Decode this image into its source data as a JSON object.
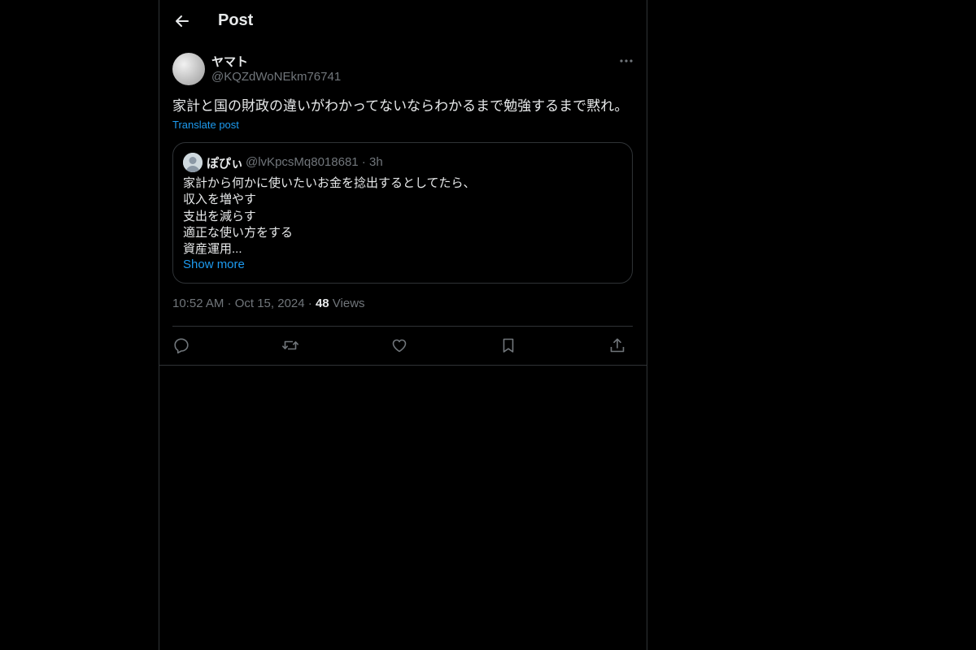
{
  "header": {
    "title": "Post",
    "back_icon": "arrow-left-icon"
  },
  "post": {
    "author_name": "ヤマト",
    "author_handle": "@KQZdWoNEkm76741",
    "text": "家計と国の財政の違いがわかってないならわかるまで勉強するまで黙れ。",
    "translate_label": "Translate post",
    "time": "10:52 AM · Oct 15, 2024 · ",
    "views_count": "48",
    "views_label": " Views"
  },
  "quote": {
    "author_name": "ぽぴぃ",
    "author_handle": "@lvKpcsMq8018681",
    "time_sep": " · ",
    "time": "3h",
    "lines": [
      "家計から何かに使いたいお金を捻出するとしてたら、",
      "収入を増やす",
      "支出を減らす",
      "適正な使い方をする",
      "資産運用..."
    ],
    "show_more": "Show more"
  },
  "actions": [
    "reply-icon",
    "repost-icon",
    "like-icon",
    "bookmark-icon",
    "share-icon"
  ],
  "colors": {
    "background": "#000000",
    "border": "#2f3336",
    "text": "#e7e9ea",
    "muted": "#71767b",
    "link": "#1d9bf0"
  }
}
